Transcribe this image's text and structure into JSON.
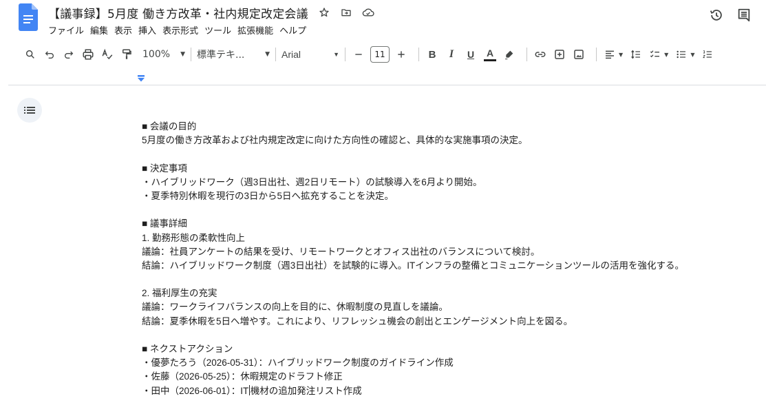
{
  "header": {
    "title": "【議事録】5月度 働き方改革・社内規定改定会議",
    "menu": [
      "ファイル",
      "編集",
      "表示",
      "挿入",
      "表示形式",
      "ツール",
      "拡張機能",
      "ヘルプ"
    ]
  },
  "toolbar": {
    "zoom": "100%",
    "style": "標準テキ...",
    "font": "Arial",
    "font_size": "11",
    "bold": "B",
    "italic": "I",
    "underline": "U",
    "text_color": "A"
  },
  "colors": {
    "docs_blue": "#4285f4",
    "ruler_marker": "#4285f4",
    "outline_bg": "#eef2f7"
  },
  "document": {
    "purpose_heading": "■ 会議の目的",
    "purpose_text": "5月度の働き方改革および社内規定改定に向けた方向性の確認と、具体的な実施事項の決定。",
    "decision_heading": "■ 決定事項",
    "decision_1": "・ハイブリッドワーク（週3日出社、週2日リモート）の試験導入を6月より開始。",
    "decision_2": "・夏季特別休暇を現行の3日から5日へ拡充することを決定。",
    "details_heading": "■ 議事詳細",
    "detail1_title": "1. 勤務形態の柔軟性向上",
    "detail1_discussion": "議論：社員アンケートの結果を受け、リモートワークとオフィス出社のバランスについて検討。",
    "detail1_conclusion": "結論：ハイブリッドワーク制度（週3日出社）を試験的に導入。ITインフラの整備とコミュニケーションツールの活用を強化する。",
    "detail2_title": "2. 福利厚生の充実",
    "detail2_discussion": "議論：ワークライフバランスの向上を目的に、休暇制度の見直しを議論。",
    "detail2_conclusion": "結論：夏季休暇を5日へ増やす。これにより、リフレッシュ機会の創出とエンゲージメント向上を図る。",
    "next_heading": "■ ネクストアクション",
    "action_1": "・優夢たろう（2026-05-31）：ハイブリッドワーク制度のガイドライン作成",
    "action_2": "・佐藤（2026-05-25）：休暇規定のドラフト修正",
    "action_3_before_cursor": "・田中（2026-06-01）：IT",
    "action_3_after_cursor": "機材の追加発注リスト作成"
  }
}
